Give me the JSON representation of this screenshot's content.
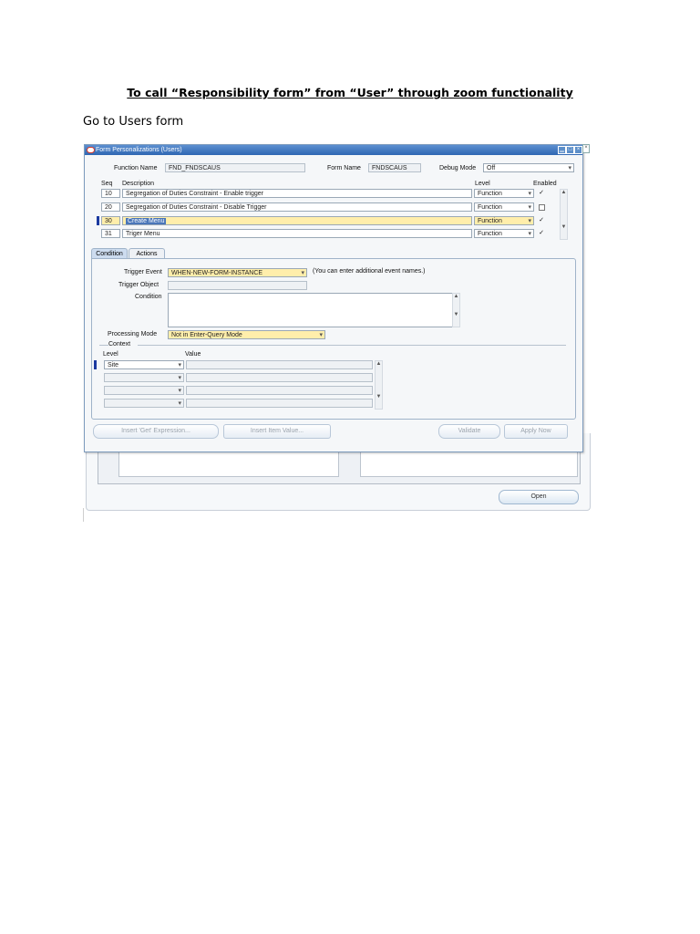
{
  "doc": {
    "title": "To call “Responsibility form” from “User” through zoom functionality",
    "intro": "Go to Users form"
  },
  "window": {
    "title": "Form Personalizations (Users)",
    "min_glyph": "▁",
    "max_glyph": "□",
    "close_glyph": "×"
  },
  "header": {
    "function_name_label": "Function Name",
    "function_name_value": "FND_FNDSCAUS",
    "form_name_label": "Form Name",
    "form_name_value": "FNDSCAUS",
    "debug_mode_label": "Debug Mode",
    "debug_mode_value": "Off"
  },
  "rules": {
    "col_seq": "Seq",
    "col_description": "Description",
    "col_level": "Level",
    "col_enabled": "Enabled",
    "rows": [
      {
        "seq": "10",
        "description": "Segregation of Duties Constraint - Enable trigger",
        "level": "Function",
        "enabled": "✓"
      },
      {
        "seq": "20",
        "description": "Segregation of Duties Constraint - Disable Trigger",
        "level": "Function",
        "enabled": ""
      },
      {
        "seq": "30",
        "description": "Create Menu",
        "level": "Function",
        "enabled": "✓"
      },
      {
        "seq": "31",
        "description": "Triger Menu",
        "level": "Function",
        "enabled": "✓"
      }
    ]
  },
  "tabs": {
    "condition": "Condition",
    "actions": "Actions"
  },
  "condition": {
    "trigger_event_label": "Trigger Event",
    "trigger_event_value": "WHEN-NEW-FORM-INSTANCE",
    "trigger_hint": "(You can enter additional event names.)",
    "trigger_object_label": "Trigger Object",
    "trigger_object_value": "",
    "condition_label": "Condition",
    "condition_value": "",
    "processing_mode_label": "Processing Mode",
    "processing_mode_value": "Not in Enter-Query Mode"
  },
  "context": {
    "legend": "Context",
    "col_level": "Level",
    "col_value": "Value",
    "rows": [
      {
        "level": "Site",
        "value": ""
      },
      {
        "level": "",
        "value": ""
      },
      {
        "level": "",
        "value": ""
      },
      {
        "level": "",
        "value": ""
      }
    ]
  },
  "buttons": {
    "insert_get_expression": "Insert 'Get' Expression...",
    "insert_item_value": "Insert Item Value...",
    "validate": "Validate",
    "apply_now": "Apply Now"
  },
  "background_window": {
    "open_button": "Open"
  },
  "icons": {
    "app": "oracle-logo-icon",
    "dropdown": "chevron-down-icon",
    "checkbox": "checkmark-icon",
    "scroll_up": "scroll-up-icon",
    "scroll_down": "scroll-down-icon"
  }
}
